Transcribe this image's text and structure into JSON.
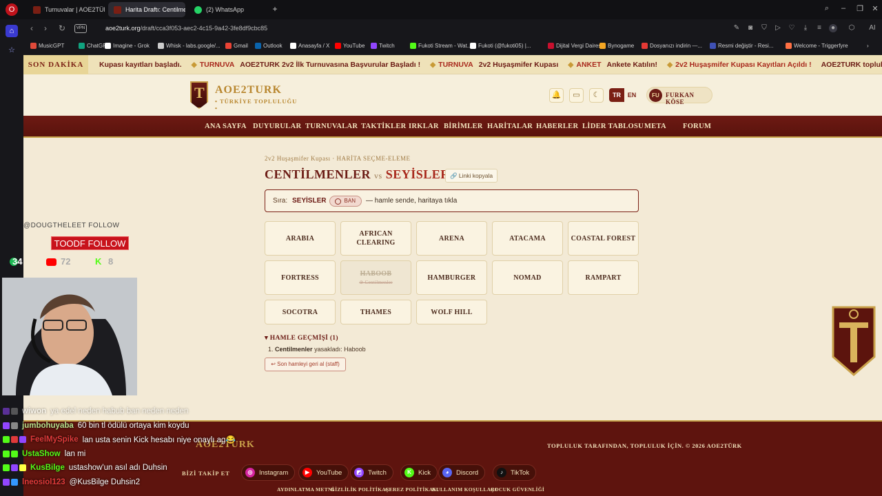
{
  "browser": {
    "tabs": [
      {
        "label": "Turnuvalar | AOE2TÜRK",
        "favicon_color": "#7a1f14"
      },
      {
        "label": "Harita Draftı: Centilmenler",
        "favicon_color": "#7a1f14"
      },
      {
        "label": "(2) WhatsApp",
        "favicon_color": "#25d366"
      }
    ],
    "url_host": "aoe2turk.org",
    "url_path": "/draft/cca3f053-aec2-4c15-9a42-3fe8df9cbc85",
    "vpn_label": "VPN",
    "bookmarks": [
      {
        "label": "MusicGPT",
        "color": "#e04a3a"
      },
      {
        "label": "ChatGPT",
        "color": "#10a37f"
      },
      {
        "label": "Imagine - Grok",
        "color": "#ffffff"
      },
      {
        "label": "Whisk - labs.google/...",
        "color": "#cccccc"
      },
      {
        "label": "Gmail",
        "color": "#ea4335"
      },
      {
        "label": "Outlook",
        "color": "#0a64ad"
      },
      {
        "label": "Anasayfa / X",
        "color": "#ffffff"
      },
      {
        "label": "YouTube",
        "color": "#ff0000"
      },
      {
        "label": "Twitch",
        "color": "#9146ff"
      },
      {
        "label": "Fukoti Stream - Wat...",
        "color": "#53fc18"
      },
      {
        "label": "Fukoti (@fukoti05) |...",
        "color": "#ffffff"
      },
      {
        "label": "Dijital Vergi Dairesi",
        "color": "#c8102e"
      },
      {
        "label": "Bynogame",
        "color": "#f5a623"
      },
      {
        "label": "Dosyanızı indirin —...",
        "color": "#e53935"
      },
      {
        "label": "Resmi değiştir - Resi...",
        "color": "#3f51b5"
      },
      {
        "label": "Welcome - Triggerfyre",
        "color": "#ff7043"
      }
    ]
  },
  "ticker": {
    "label": "SON DAKİKA",
    "items": [
      {
        "tag": "",
        "text": "Kupası kayıtları başladı."
      },
      {
        "tag": "TURNUVA",
        "text": "AOE2TURK 2v2 İlk Turnuvasına Başvurular Başladı !"
      },
      {
        "tag": "TURNUVA",
        "text": "2v2 Huşaşmifer Kupası"
      },
      {
        "tag": "ANKET",
        "text": "Ankete Katılın!"
      },
      {
        "tag": "",
        "text": "2v2 Huşaşmifer Kupası Kayıtları Açıldı !"
      },
      {
        "tag": "",
        "text": "AOE2TURK topluluğu"
      }
    ]
  },
  "site": {
    "logo_title": "AOE2TURK",
    "logo_subtitle": "• TÜRKİYE TOPLULUĞU •",
    "lang_active": "TR",
    "lang_other": "EN",
    "user_initials": "FU",
    "user_name": "FURKAN KÖSE",
    "nav": [
      "ANA SAYFA",
      "DUYURULAR",
      "TURNUVALAR",
      "TAKTİKLER",
      "IRKLAR",
      "BİRİMLER",
      "HARİTALAR",
      "HABERLER",
      "LİDER TABLOSU",
      "META",
      "FORUM"
    ]
  },
  "draft": {
    "breadcrumb": "2v2 Huşaşmifer Kupası · HARİTA SEÇME-ELEME",
    "team1": "CENTİLMENLER",
    "vs": "vs",
    "team2": "SEYİSLER",
    "copy_label": "Linki kopyala",
    "turn_label": "Sıra:",
    "turn_team": "SEYİSLER",
    "turn_action": "BAN",
    "turn_message": "— hamle sende, haritaya tıkla",
    "maps": [
      {
        "name": "ARABIA",
        "banned": false,
        "banned_by": ""
      },
      {
        "name": "AFRICAN CLEARING",
        "banned": false,
        "banned_by": ""
      },
      {
        "name": "ARENA",
        "banned": false,
        "banned_by": ""
      },
      {
        "name": "ATACAMA",
        "banned": false,
        "banned_by": ""
      },
      {
        "name": "COASTAL FOREST",
        "banned": false,
        "banned_by": ""
      },
      {
        "name": "FORTRESS",
        "banned": false,
        "banned_by": ""
      },
      {
        "name": "HABOOB",
        "banned": true,
        "banned_by": "Centilmenler"
      },
      {
        "name": "HAMBURGER",
        "banned": false,
        "banned_by": ""
      },
      {
        "name": "NOMAD",
        "banned": false,
        "banned_by": ""
      },
      {
        "name": "RAMPART",
        "banned": false,
        "banned_by": ""
      },
      {
        "name": "SOCOTRA",
        "banned": false,
        "banned_by": ""
      },
      {
        "name": "THAMES",
        "banned": false,
        "banned_by": ""
      },
      {
        "name": "WOLF HILL",
        "banned": false,
        "banned_by": ""
      }
    ],
    "history_title": "HAMLE GEÇMİŞİ (1)",
    "history": [
      {
        "index": "1.",
        "team": "Centilmenler",
        "action": "yasakladı:",
        "map": "Haboob"
      }
    ],
    "undo_label": "↩ Son hamleyi geri al (staff)"
  },
  "footer": {
    "logo": "AOE2TURK",
    "copyright": "TOPLULUK TARAFINDAN, TOPLULUK İÇİN. © 2026 AOE2TÜRK",
    "follow_label": "BİZİ TAKİP ET",
    "socials": [
      {
        "label": "Instagram",
        "color": "#d6249f"
      },
      {
        "label": "YouTube",
        "color": "#ff0000"
      },
      {
        "label": "Twitch",
        "color": "#9146ff"
      },
      {
        "label": "Kick",
        "color": "#53fc18"
      },
      {
        "label": "Discord",
        "color": "#5865f2"
      },
      {
        "label": "TikTok",
        "color": "#111111"
      }
    ],
    "links": [
      "AYDINLATMA METNİ",
      "GİZLİLİK POLİTİKASI",
      "ÇEREZ POLİTİKASI",
      "KULLANIM KOŞULLARI",
      "ÇOCUK GÜVENLİĞİ"
    ]
  },
  "stream_overlay": {
    "follow_text": "@DOUGTHELEET FOLLOW",
    "alert_text": "TOODF FOLLOW",
    "count_spotify": "34",
    "count_youtube": "72",
    "count_kick": "8",
    "chat": [
      {
        "nick": "wiwon",
        "msg": "ya edel neden habub ban neden neden",
        "color": "#ffffff",
        "dim": true
      },
      {
        "nick": "jumbohuyaba",
        "msg": "60 bin tl ödülü ortaya kim koydu",
        "color": "#b7e08c",
        "dim": false
      },
      {
        "nick": "FeelMySpike",
        "msg": "lan usta senin Kick hesabı niye onaylı ag😂",
        "color": "#e03a3a",
        "dim": false
      },
      {
        "nick": "UstaShow",
        "msg": "lan mi",
        "color": "#53fc18",
        "dim": false
      },
      {
        "nick": "KusBilge",
        "msg": "ustashow'un asıl adı Duhsin",
        "color": "#53fc18",
        "dim": false
      },
      {
        "nick": "lneosiol123",
        "msg": "@KusBilge Duhsin2",
        "color": "#e03a3a",
        "dim": false
      }
    ]
  }
}
